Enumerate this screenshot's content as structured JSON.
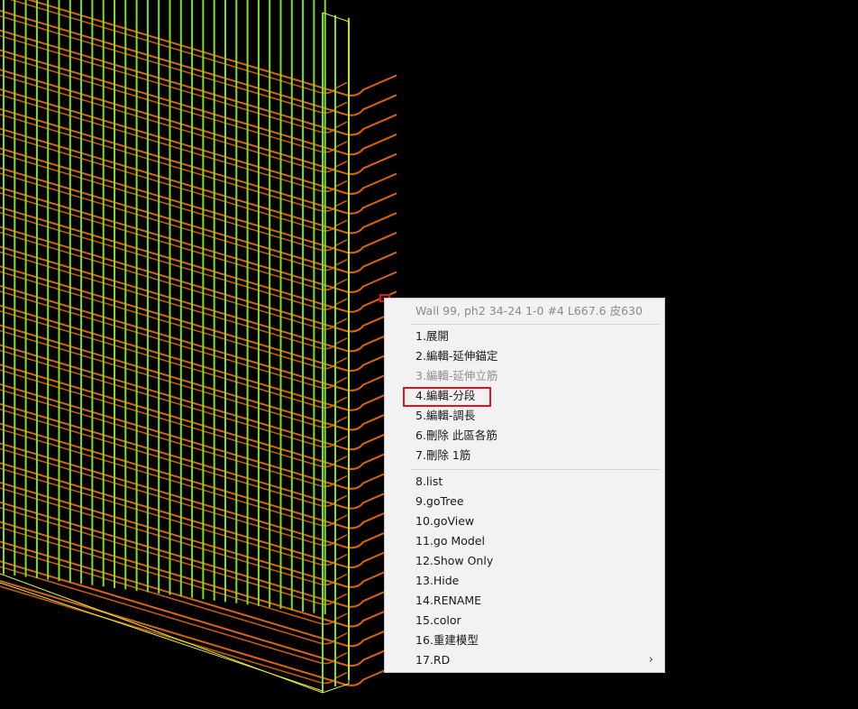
{
  "viewport": {
    "background": "#000000",
    "colors": {
      "vertical_bars": "#7fe020",
      "horizontal_bars": "#d9640f",
      "outline": "#e8f23a"
    }
  },
  "context_menu": {
    "header": "Wall 99, ph2 34-24 1-0 #4 L667.6 皮630",
    "group1": [
      {
        "label": "1.展開",
        "enabled": true
      },
      {
        "label": "2.編輯-延伸錨定",
        "enabled": true
      },
      {
        "label": "3.編輯-延伸立筋",
        "enabled": false
      },
      {
        "label": "4.編輯-分段",
        "enabled": true,
        "highlighted": true
      },
      {
        "label": "5.編輯-調長",
        "enabled": true
      },
      {
        "label": "6.刪除 此區各筋",
        "enabled": true
      },
      {
        "label": "7.刪除 1筋",
        "enabled": true
      }
    ],
    "group2": [
      {
        "label": "8.list"
      },
      {
        "label": "9.goTree"
      },
      {
        "label": "10.goView"
      },
      {
        "label": "11.go Model"
      },
      {
        "label": "12.Show Only"
      },
      {
        "label": "13.Hide"
      },
      {
        "label": "14.RENAME"
      },
      {
        "label": "15.color"
      },
      {
        "label": "16.重建模型"
      },
      {
        "label": "17.RD",
        "submenu_icon": "chevron-right-icon"
      }
    ],
    "highlight_color": "#e0141d"
  }
}
